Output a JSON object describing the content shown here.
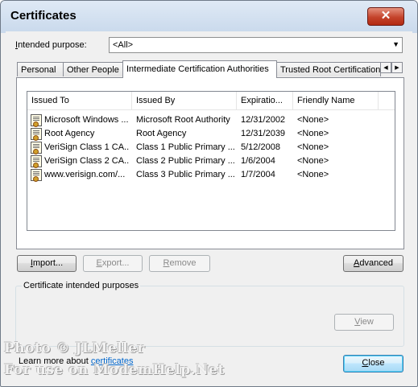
{
  "window": {
    "title": "Certificates",
    "close_glyph": "✕"
  },
  "intended_purpose": {
    "label_prefix": "I",
    "label_rest": "ntended purpose:",
    "value": "<All>",
    "arrow": "▼"
  },
  "tabs": [
    {
      "label": "Personal"
    },
    {
      "label": "Other People"
    },
    {
      "label": "Intermediate Certification Authorities"
    },
    {
      "label": "Trusted Root Certification"
    }
  ],
  "tab_scroll": {
    "left": "◀",
    "right": "▶"
  },
  "columns": [
    "Issued To",
    "Issued By",
    "Expiratio...",
    "Friendly Name"
  ],
  "rows": [
    {
      "issued_to": "Microsoft Windows ...",
      "issued_by": "Microsoft Root Authority",
      "expiration": "12/31/2002",
      "friendly": "<None>"
    },
    {
      "issued_to": "Root Agency",
      "issued_by": "Root Agency",
      "expiration": "12/31/2039",
      "friendly": "<None>"
    },
    {
      "issued_to": "VeriSign Class 1 CA...",
      "issued_by": "Class 1 Public Primary ...",
      "expiration": "5/12/2008",
      "friendly": "<None>"
    },
    {
      "issued_to": "VeriSign Class 2 CA...",
      "issued_by": "Class 2 Public Primary ...",
      "expiration": "1/6/2004",
      "friendly": "<None>"
    },
    {
      "issued_to": "www.verisign.com/...",
      "issued_by": "Class 3 Public Primary ...",
      "expiration": "1/7/2004",
      "friendly": "<None>"
    }
  ],
  "buttons": {
    "import": {
      "u": "I",
      "rest": "mport..."
    },
    "export": {
      "u": "E",
      "rest": "xport..."
    },
    "remove": {
      "u": "R",
      "rest": "emove"
    },
    "advanced": {
      "u": "A",
      "rest": "dvanced"
    },
    "view": {
      "u": "V",
      "rest": "iew"
    },
    "close": {
      "u": "C",
      "rest": "lose"
    }
  },
  "group": {
    "label": "Certificate intended purposes"
  },
  "learn": {
    "text": "Learn more about ",
    "link": "certificates"
  },
  "watermark": {
    "line1": "Photo © JLMeller",
    "line2": "For use on ModemHelp.Net"
  },
  "colors": {
    "title_close": "#c4432b",
    "link": "#0066cc",
    "default_button": "#3c7fb1"
  }
}
